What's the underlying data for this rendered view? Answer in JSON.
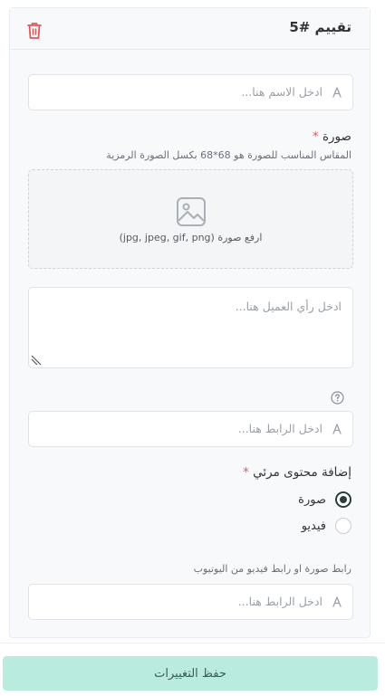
{
  "card": {
    "title": "تقييم #5"
  },
  "name_field": {
    "placeholder": "ادخل الاسم هنا..."
  },
  "image_section": {
    "label": "صورة",
    "required_mark": "*",
    "hint": "المقاس المناسب للصورة هو 68*68 بكسل الصورة الرمزية",
    "upload_text": "ارفع صورة (jpg, jpeg, gif, png)"
  },
  "opinion_field": {
    "placeholder": "ادخل رأي العميل هنا..."
  },
  "link_field": {
    "placeholder": "ادخل الرابط هنا..."
  },
  "media_section": {
    "label": "إضافة محتوى مرئي",
    "required_mark": "*",
    "options": [
      {
        "label": "صورة",
        "selected": true
      },
      {
        "label": "فيديو",
        "selected": false
      }
    ],
    "url_label": "رابط صورة او رابط فيديو من اليوتيوب",
    "url_placeholder": "ادخل الرابط هنا..."
  },
  "save_button": {
    "label": "حفظ التغييرات"
  },
  "colors": {
    "accent": "#b9ecdf",
    "danger": "#e05a5a",
    "radio_selected": "#2c3e3a"
  },
  "icons": {
    "delete": "trash-icon",
    "input_prefix": "person-icon",
    "upload": "image-icon",
    "help": "help-circle-icon",
    "resize": "resize-handle-icon"
  }
}
